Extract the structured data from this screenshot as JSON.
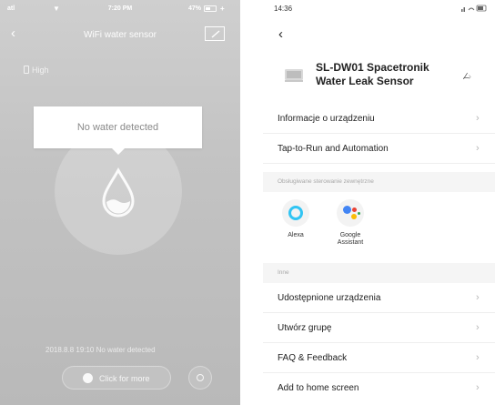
{
  "left_phone": {
    "status_bar": {
      "signal": "atl",
      "time": "7:20 PM",
      "battery": "47%"
    },
    "title": "WiFi water sensor",
    "battery_level_label": "High",
    "status_message": "No water detected",
    "history_entry": "2018.8.8 19:10 No water detected",
    "more_button_label": "Click for more",
    "colors": {
      "background": "#c4c4c4",
      "card": "#ffffff"
    },
    "icons": [
      "back-icon",
      "edit-icon",
      "battery-icon",
      "water-drop-icon",
      "settings-icon"
    ]
  },
  "right_phone": {
    "status_bar": {
      "time": "14:36"
    },
    "device_name": "SL-DW01 Spacetronik Water Leak Sensor",
    "menu_top": [
      {
        "label": "Informacje o urządzeniu"
      },
      {
        "label": "Tap-to-Run and Automation"
      }
    ],
    "section_services_title": "Obsługiwane sterowanie zewnętrzne",
    "services": [
      {
        "label": "Alexa"
      },
      {
        "label": "Google Assistant"
      }
    ],
    "section_other_title": "Inne",
    "menu_bottom": [
      {
        "label": "Udostępnione urządzenia"
      },
      {
        "label": "Utwórz grupę"
      },
      {
        "label": "FAQ & Feedback"
      },
      {
        "label": "Add to home screen"
      }
    ],
    "colors": {
      "alexa": "#31c4f3",
      "google_blue": "#4285f4",
      "google_red": "#ea4335",
      "google_yellow": "#fbbc05",
      "google_green": "#34a853"
    }
  }
}
